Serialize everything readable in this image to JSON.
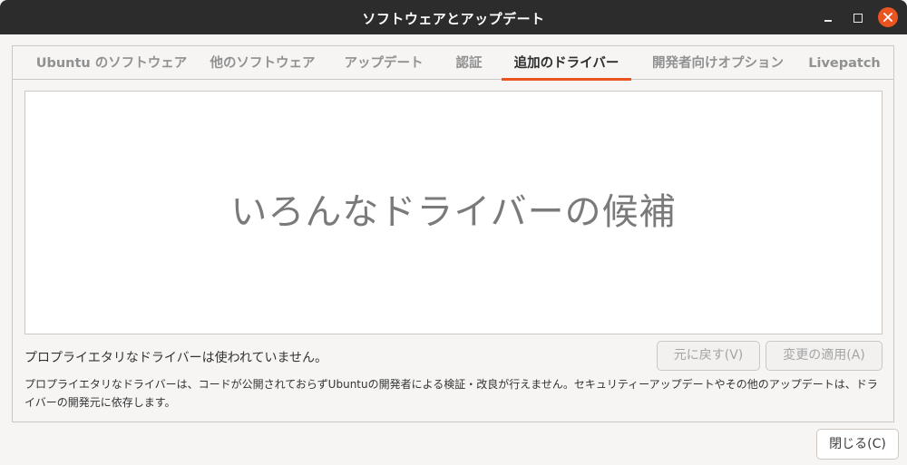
{
  "window": {
    "title": "ソフトウェアとアップデート",
    "controls": {
      "minimize": "minimize-icon",
      "maximize": "maximize-icon",
      "close": "close-icon"
    }
  },
  "tabs": [
    {
      "label": "Ubuntu のソフトウェア",
      "active": false
    },
    {
      "label": "他のソフトウェア",
      "active": false
    },
    {
      "label": "アップデート",
      "active": false
    },
    {
      "label": "認証",
      "active": false
    },
    {
      "label": "追加のドライバー",
      "active": true
    },
    {
      "label": "開発者向けオプション",
      "active": false
    },
    {
      "label": "Livepatch",
      "active": false
    }
  ],
  "drivers": {
    "placeholder": "いろんなドライバーの候補"
  },
  "status": {
    "text": "プロプライエタリなドライバーは使われていません。"
  },
  "buttons": {
    "revert": "元に戻す(V)",
    "apply": "変更の適用(A)",
    "close": "閉じる(C)"
  },
  "description": "プロプライエタリなドライバーは、コードが公開されておらずUbuntuの開発者による検証・改良が行えません。セキュリティーアップデートやその他のアップデートは、ドライバーの開発元に依存します。",
  "colors": {
    "accent": "#e95420",
    "titlebar": "#2c2c2c",
    "background": "#f6f5f4"
  }
}
